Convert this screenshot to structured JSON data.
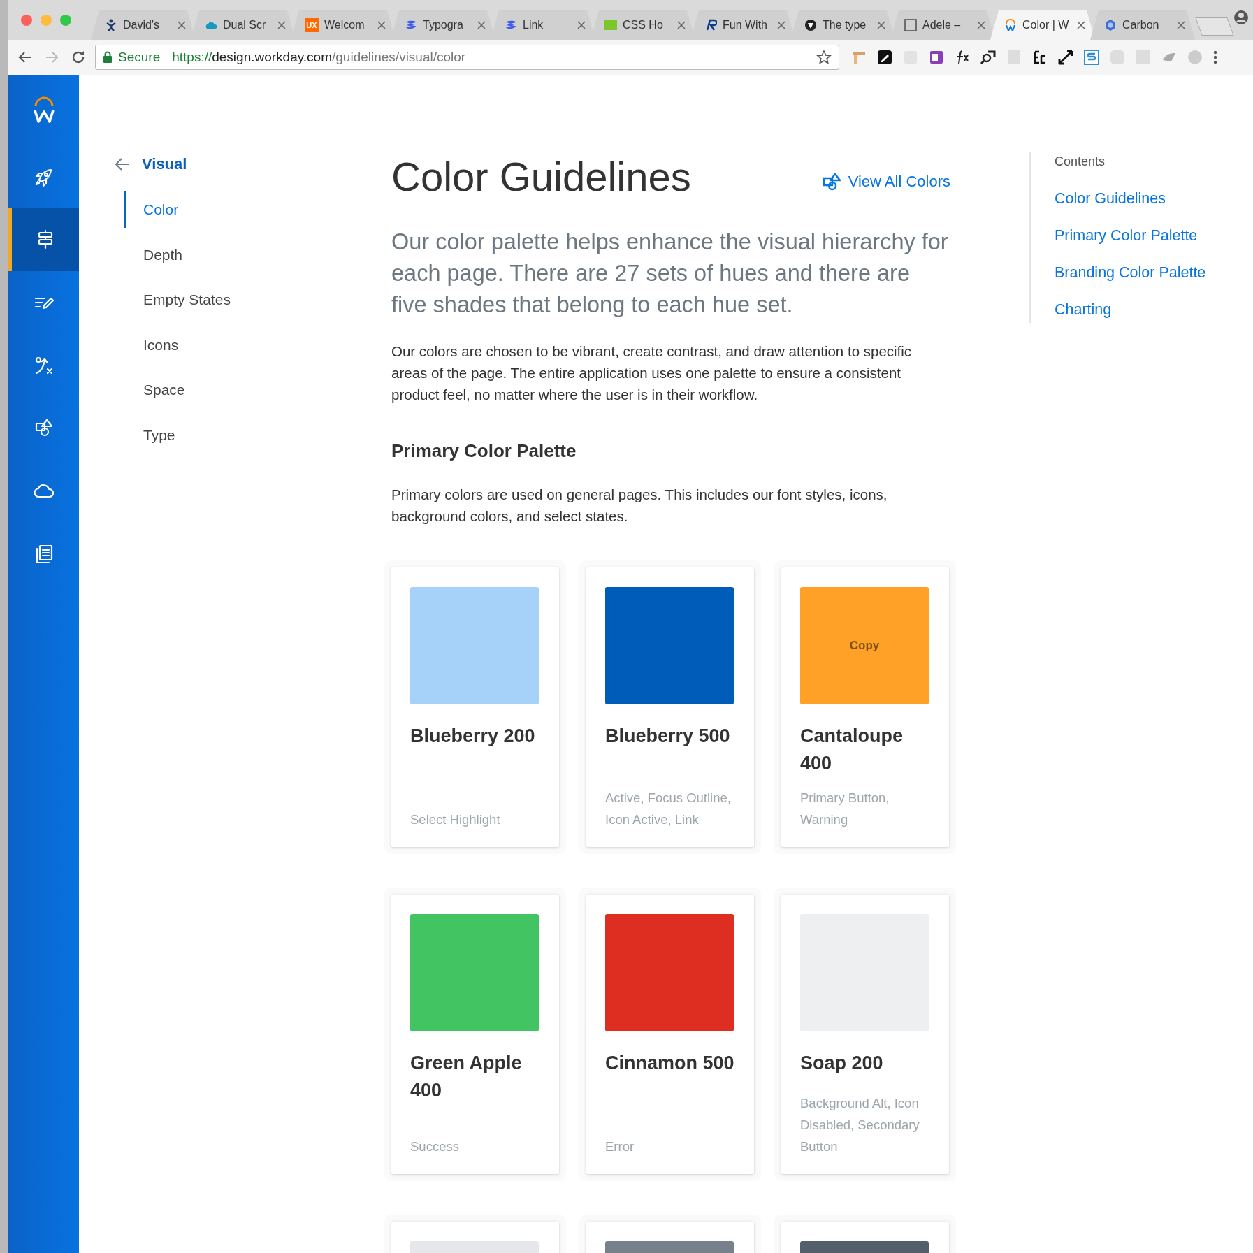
{
  "browser": {
    "tabs": [
      {
        "title": "David's",
        "kind": "figure",
        "selected": false
      },
      {
        "title": "Dual Scr",
        "kind": "cloud",
        "selected": false
      },
      {
        "title": "Welcom",
        "kind": "ux",
        "icon_text": "UX",
        "selected": false
      },
      {
        "title": "Typogra",
        "kind": "stripe",
        "selected": false
      },
      {
        "title": "Link",
        "kind": "stripe",
        "selected": false
      },
      {
        "title": "CSS Ho",
        "kind": "green",
        "selected": false
      },
      {
        "title": "Fun With",
        "kind": "letter",
        "selected": false
      },
      {
        "title": "The type",
        "kind": "circle",
        "selected": false
      },
      {
        "title": "Adele –",
        "kind": "square",
        "selected": false
      },
      {
        "title": "Color | W",
        "kind": "arc",
        "selected": true
      },
      {
        "title": "Carbon",
        "kind": "hexagon",
        "selected": false
      }
    ],
    "address": {
      "secure_label": "Secure",
      "scheme": "https://",
      "host": "design.workday.com",
      "path": "/guidelines/visual/color"
    }
  },
  "app_rail": {
    "items": [
      {
        "kind": "logo",
        "selected": false
      },
      {
        "kind": "rocket",
        "selected": false
      },
      {
        "kind": "signpost",
        "selected": true
      },
      {
        "kind": "edit",
        "selected": false
      },
      {
        "kind": "strategy",
        "selected": false
      },
      {
        "kind": "shapes",
        "selected": false
      },
      {
        "kind": "cloud",
        "selected": false
      },
      {
        "kind": "docs",
        "selected": false
      }
    ]
  },
  "nav": {
    "back_label": "Visual",
    "items": [
      {
        "label": "Color",
        "selected": true
      },
      {
        "label": "Depth",
        "selected": false
      },
      {
        "label": "Empty States",
        "selected": false
      },
      {
        "label": "Icons",
        "selected": false
      },
      {
        "label": "Space",
        "selected": false
      },
      {
        "label": "Type",
        "selected": false
      }
    ]
  },
  "page": {
    "title": "Color Guidelines",
    "view_all_link": "View All Colors",
    "lead": "Our color palette helps enhance the visual hierarchy for each page. There are 27 sets of hues and there are five shades that belong to each hue set.",
    "intro": "Our colors are chosen to be vibrant, create contrast, and draw attention to specific areas of the page. The entire application uses one palette to ensure a consistent product feel, no matter where the user is in their workflow.",
    "section_heading": "Primary Color Palette",
    "section_text": "Primary colors are used on general pages. This includes our font styles, icons, background colors, and select states.",
    "cards": [
      {
        "name": "Blueberry 200",
        "color": "#a6d2fa",
        "usage": "Select Highlight"
      },
      {
        "name": "Blueberry 500",
        "color": "#005cb9",
        "usage": "Active, Focus Outline, Icon Active, Link"
      },
      {
        "name": "Cantaloupe 400",
        "color": "#ffa126",
        "usage": "Primary Button, Warning",
        "copy_label": "Copy"
      },
      {
        "name": "Green Apple 400",
        "color": "#43c463",
        "usage": "Success"
      },
      {
        "name": "Cinnamon 500",
        "color": "#de2e21",
        "usage": "Error"
      },
      {
        "name": "Soap 200",
        "color": "#edeff0",
        "usage": "Background Alt, Icon Disabled, Secondary Button"
      },
      {
        "color": "#e6e7ea"
      },
      {
        "color": "#76818b"
      },
      {
        "color": "#535f6b"
      }
    ]
  },
  "toc": {
    "heading": "Contents",
    "links": [
      "Color Guidelines",
      "Primary Color Palette",
      "Branding Color Palette",
      "Charting"
    ]
  }
}
